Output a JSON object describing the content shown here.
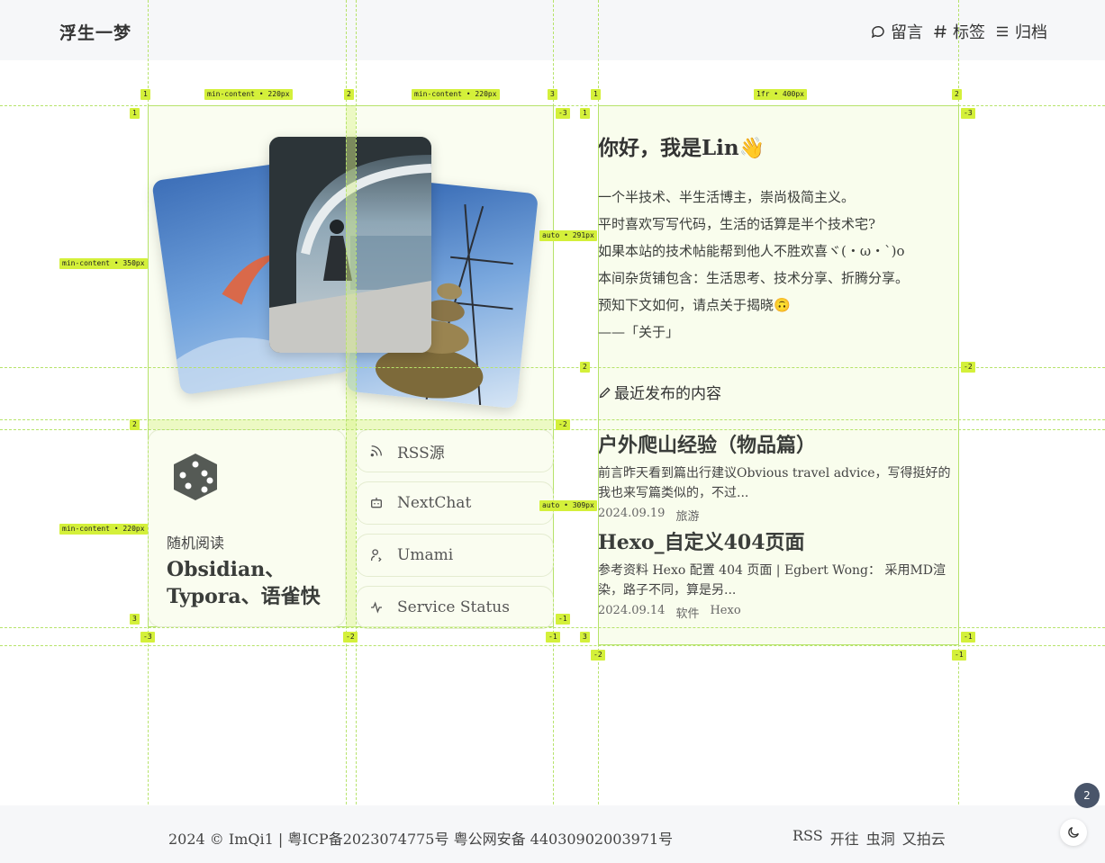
{
  "header": {
    "brand": "浮生一梦",
    "nav": [
      {
        "label": "留言",
        "icon": "chat-bubble-icon"
      },
      {
        "label": "标签",
        "icon": "hash-icon"
      },
      {
        "label": "归档",
        "icon": "menu-list-icon"
      }
    ]
  },
  "grid_overlay": {
    "left_columns": [
      "min-content • 220px",
      "min-content • 220px"
    ],
    "left_rows": [
      "min-content • 350px",
      "min-content • 220px"
    ],
    "right_columns": [
      "1fr • 400px"
    ],
    "right_rows": [
      "auto • 291px",
      "auto • 309px"
    ],
    "line_numbers": [
      "1",
      "2",
      "3",
      "-1",
      "-2",
      "-3"
    ]
  },
  "random": {
    "icon": "dice-icon",
    "label": "随机阅读",
    "title": "Obsidian、Typora、语雀快"
  },
  "links": [
    {
      "label": "RSS源",
      "icon": "rss-icon"
    },
    {
      "label": "NextChat",
      "icon": "robot-icon"
    },
    {
      "label": "Umami",
      "icon": "user-analytics-icon"
    },
    {
      "label": "Service Status",
      "icon": "activity-pulse-icon"
    }
  ],
  "intro": {
    "greeting": "你好，我是Lin👋",
    "lines": [
      "一个半技术、半生活博主，崇尚极简主义。",
      "平时喜欢写写代码，生活的话算是半个技术宅?",
      "如果本站的技术帖能帮到他人不胜欢喜ヾ(・ω・`)o",
      "本间杂货铺包含：生活思考、技术分享、折腾分享。",
      "预知下文如何，请点关于揭晓🙃",
      "——「关于」"
    ],
    "recent_heading": "最近发布的内容"
  },
  "posts": [
    {
      "title": "户外爬山经验（物品篇）",
      "excerpt": "前言昨天看到篇出行建议Obvious travel advice，写得挺好的我也来写篇类似的，不过...",
      "date": "2024.09.19",
      "tags": [
        "旅游"
      ]
    },
    {
      "title": "Hexo_自定义404页面",
      "excerpt": "参考资料 Hexo 配置 404 页面 | Egbert Wong： 采用MD渲染，路子不同，算是另...",
      "date": "2024.09.14",
      "tags": [
        "软件",
        "Hexo"
      ]
    }
  ],
  "footer": {
    "copyright": "2024 © ImQi1  | 粤ICP备2023074775号 粤公网安备 44030902003971号",
    "links": [
      "RSS",
      "开往",
      "虫洞",
      "又拍云"
    ]
  },
  "badge": "2"
}
